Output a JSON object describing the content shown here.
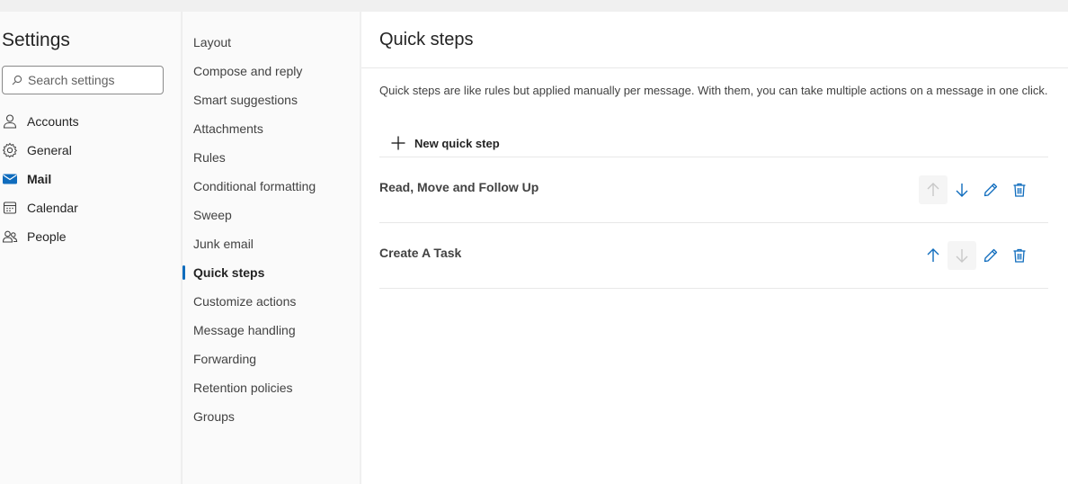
{
  "settings": {
    "title": "Settings",
    "search_placeholder": "Search settings",
    "categories": [
      {
        "label": "Accounts",
        "icon": "person-icon"
      },
      {
        "label": "General",
        "icon": "gear-icon"
      },
      {
        "label": "Mail",
        "icon": "mail-icon",
        "active": true
      },
      {
        "label": "Calendar",
        "icon": "calendar-icon"
      },
      {
        "label": "People",
        "icon": "people-icon"
      }
    ]
  },
  "mail_nav": {
    "items": [
      "Layout",
      "Compose and reply",
      "Smart suggestions",
      "Attachments",
      "Rules",
      "Conditional formatting",
      "Sweep",
      "Junk email",
      "Quick steps",
      "Customize actions",
      "Message handling",
      "Forwarding",
      "Retention policies",
      "Groups"
    ],
    "active_item": "Quick steps"
  },
  "panel": {
    "title": "Quick steps",
    "description": "Quick steps are like rules but applied manually per message. With them, you can take multiple actions on a message in one click.",
    "new_button_label": "New quick step",
    "quick_steps": [
      {
        "name": "Read, Move and Follow Up",
        "move_up_enabled": false,
        "move_down_enabled": true
      },
      {
        "name": "Create A Task",
        "move_up_enabled": true,
        "move_down_enabled": false
      }
    ]
  },
  "colors": {
    "accent": "#0f6cbd",
    "disabled_icon": "#c8c8c8",
    "disabled_bg": "#f5f5f5"
  }
}
